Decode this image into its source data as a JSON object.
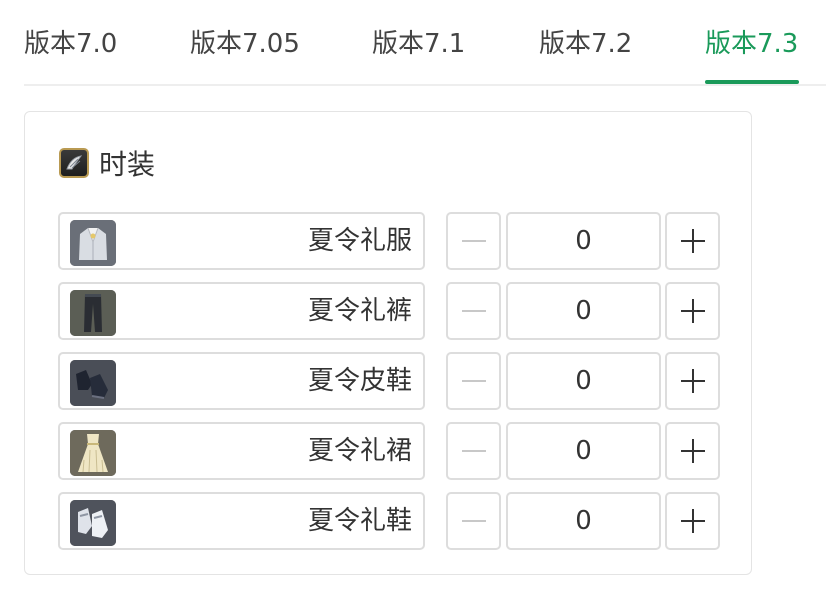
{
  "tabs": [
    {
      "label": "版本7.0",
      "active": false
    },
    {
      "label": "版本7.05",
      "active": false
    },
    {
      "label": "版本7.1",
      "active": false
    },
    {
      "label": "版本7.2",
      "active": false
    },
    {
      "label": "版本7.3",
      "active": true
    }
  ],
  "colors": {
    "accent": "#1a9a5a",
    "border": "#dddddd",
    "text": "#333333"
  },
  "section": {
    "title": "时装",
    "icon": "fashion-icon"
  },
  "items": [
    {
      "name": "夏令礼服",
      "quantity": "0",
      "icon": "summer-formal-coat-icon"
    },
    {
      "name": "夏令礼裤",
      "quantity": "0",
      "icon": "summer-formal-trousers-icon"
    },
    {
      "name": "夏令皮鞋",
      "quantity": "0",
      "icon": "summer-leather-shoes-icon"
    },
    {
      "name": "夏令礼裙",
      "quantity": "0",
      "icon": "summer-formal-dress-icon"
    },
    {
      "name": "夏令礼鞋",
      "quantity": "0",
      "icon": "summer-formal-shoes-icon"
    }
  ]
}
